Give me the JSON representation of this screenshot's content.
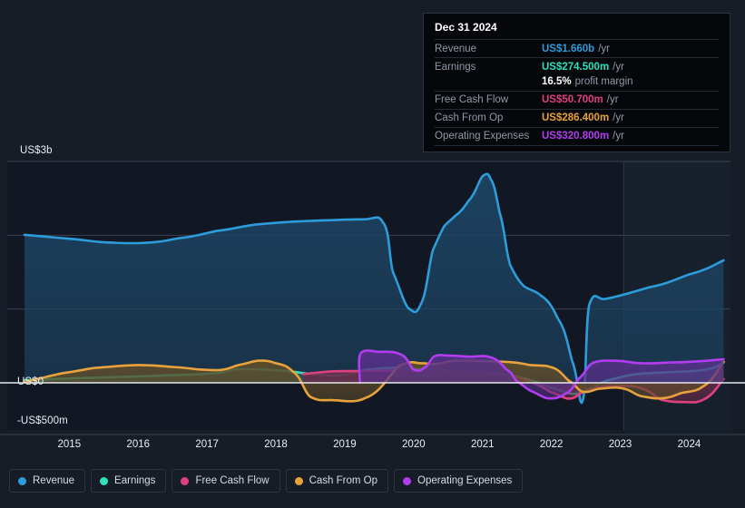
{
  "background": "#171d27",
  "axis": {
    "y_labels": [
      {
        "text": "US$3b",
        "value": 3000
      },
      {
        "text": "US$0",
        "value": 0
      },
      {
        "text": "-US$500m",
        "value": -500
      }
    ],
    "x_labels": [
      "2015",
      "2016",
      "2017",
      "2018",
      "2019",
      "2020",
      "2021",
      "2022",
      "2023",
      "2024"
    ]
  },
  "tooltip": {
    "date": "Dec 31 2024",
    "rows": [
      {
        "key": "Revenue",
        "value": "US$1.660b",
        "unit": "/yr",
        "color": "#2d9cdb"
      },
      {
        "key": "Earnings",
        "value": "US$274.500m",
        "unit": "/yr",
        "color": "#2ee0bb"
      },
      {
        "key": "",
        "value": "16.5%",
        "unit": "profit margin",
        "color": "#ffffff",
        "sub": true
      },
      {
        "key": "Free Cash Flow",
        "value": "US$50.700m",
        "unit": "/yr",
        "color": "#e0407e"
      },
      {
        "key": "Cash From Op",
        "value": "US$286.400m",
        "unit": "/yr",
        "color": "#e8a23c"
      },
      {
        "key": "Operating Expenses",
        "value": "US$320.800m",
        "unit": "/yr",
        "color": "#b23df0"
      }
    ]
  },
  "legend": [
    {
      "label": "Revenue",
      "color": "#2d9cdb"
    },
    {
      "label": "Earnings",
      "color": "#2ee0bb"
    },
    {
      "label": "Free Cash Flow",
      "color": "#e0407e"
    },
    {
      "label": "Cash From Op",
      "color": "#e8a23c"
    },
    {
      "label": "Operating Expenses",
      "color": "#b23df0"
    }
  ],
  "chart_data": {
    "type": "area",
    "title": "",
    "xlabel": "",
    "ylabel": "US$",
    "xlim": [
      2014.6,
      2025.1
    ],
    "ylim": [
      -640,
      3200
    ],
    "yticks": [
      3000,
      2000,
      1000,
      0,
      -500
    ],
    "ytick_labels_shown": [
      "US$3b",
      "US$0",
      "-US$500m"
    ],
    "grid": true,
    "legend_position": "bottom-left",
    "units": "US$ millions",
    "forecast_band_start": 2023.55,
    "series": [
      {
        "name": "Revenue",
        "color": "#2d9cdb",
        "fill": "#1d4463",
        "x": [
          2014.85,
          2015.4,
          2016.0,
          2016.55,
          2017.1,
          2017.65,
          2018.2,
          2018.75,
          2019.3,
          2019.75,
          2020.05,
          2020.2,
          2020.42,
          2020.6,
          2020.78,
          2020.95,
          2021.1,
          2021.3,
          2021.5,
          2021.62,
          2021.75,
          2021.9,
          2022.1,
          2022.35,
          2022.6,
          2022.8,
          2022.95,
          2023.05,
          2023.3,
          2023.9,
          2024.5,
          2025.0
        ],
        "y": [
          2005,
          1960,
          1905,
          1895,
          1960,
          2060,
          2145,
          2185,
          2205,
          2215,
          2180,
          1500,
          1015,
          1060,
          1800,
          2130,
          2260,
          2470,
          2800,
          2760,
          2300,
          1600,
          1310,
          1180,
          860,
          300,
          -250,
          1060,
          1140,
          1290,
          1470,
          1660
        ]
      },
      {
        "name": "Earnings",
        "color": "#2ee0bb",
        "fill": "#2c5f5c",
        "x": [
          2014.85,
          2015.5,
          2016.2,
          2017.0,
          2017.6,
          2017.95,
          2018.5,
          2019.0,
          2019.4,
          2019.8,
          2020.2,
          2020.5,
          2020.8,
          2021.1,
          2021.5,
          2021.9,
          2022.2,
          2022.5,
          2022.8,
          2023.0,
          2023.3,
          2023.7,
          2024.2,
          2024.7,
          2025.0
        ],
        "y": [
          35,
          60,
          80,
          105,
          130,
          185,
          170,
          120,
          100,
          175,
          205,
          195,
          175,
          150,
          125,
          95,
          30,
          -70,
          -150,
          -95,
          30,
          115,
          145,
          175,
          274
        ]
      },
      {
        "name": "Free Cash Flow",
        "color": "#e0407e",
        "fill": "#6b2b4a",
        "x": [
          2018.9,
          2019.3,
          2019.8,
          2020.3,
          2020.8,
          2021.2,
          2021.6,
          2021.9,
          2022.2,
          2022.5,
          2022.75,
          2022.95,
          2023.2,
          2023.5,
          2023.8,
          2024.1,
          2024.4,
          2024.7,
          2025.0
        ],
        "y": [
          120,
          155,
          160,
          165,
          150,
          140,
          130,
          95,
          10,
          -130,
          -215,
          -130,
          -55,
          -40,
          -75,
          -230,
          -260,
          -230,
          51
        ]
      },
      {
        "name": "Cash From Op",
        "color": "#e8a23c",
        "fill": "#5e4c2a",
        "x": [
          2014.85,
          2015.4,
          2015.9,
          2016.5,
          2017.0,
          2017.4,
          2017.7,
          2017.95,
          2018.25,
          2018.5,
          2018.75,
          2019.0,
          2019.3,
          2019.8,
          2020.3,
          2020.6,
          2020.8,
          2021.1,
          2021.5,
          2021.9,
          2022.2,
          2022.5,
          2022.75,
          2022.95,
          2023.2,
          2023.5,
          2023.8,
          2024.1,
          2024.4,
          2024.7,
          2025.0
        ],
        "y": [
          15,
          130,
          205,
          240,
          215,
          180,
          175,
          240,
          300,
          265,
          150,
          -190,
          -235,
          -205,
          235,
          265,
          255,
          300,
          295,
          280,
          240,
          210,
          30,
          -120,
          -80,
          -70,
          -180,
          -210,
          -135,
          -50,
          286
        ]
      },
      {
        "name": "Operating Expenses",
        "color": "#b23df0",
        "fill": "#58308a",
        "x": [
          2019.72,
          2019.73,
          2020.0,
          2020.3,
          2020.5,
          2020.65,
          2020.8,
          2021.0,
          2021.3,
          2021.6,
          2021.85,
          2022.0,
          2022.2,
          2022.45,
          2022.7,
          2022.9,
          2023.1,
          2023.4,
          2023.8,
          2024.2,
          2024.6,
          2025.0
        ],
        "y": [
          0,
          400,
          420,
          390,
          180,
          200,
          360,
          370,
          355,
          350,
          180,
          20,
          -110,
          -210,
          -150,
          60,
          270,
          300,
          265,
          275,
          290,
          320
        ]
      }
    ]
  }
}
